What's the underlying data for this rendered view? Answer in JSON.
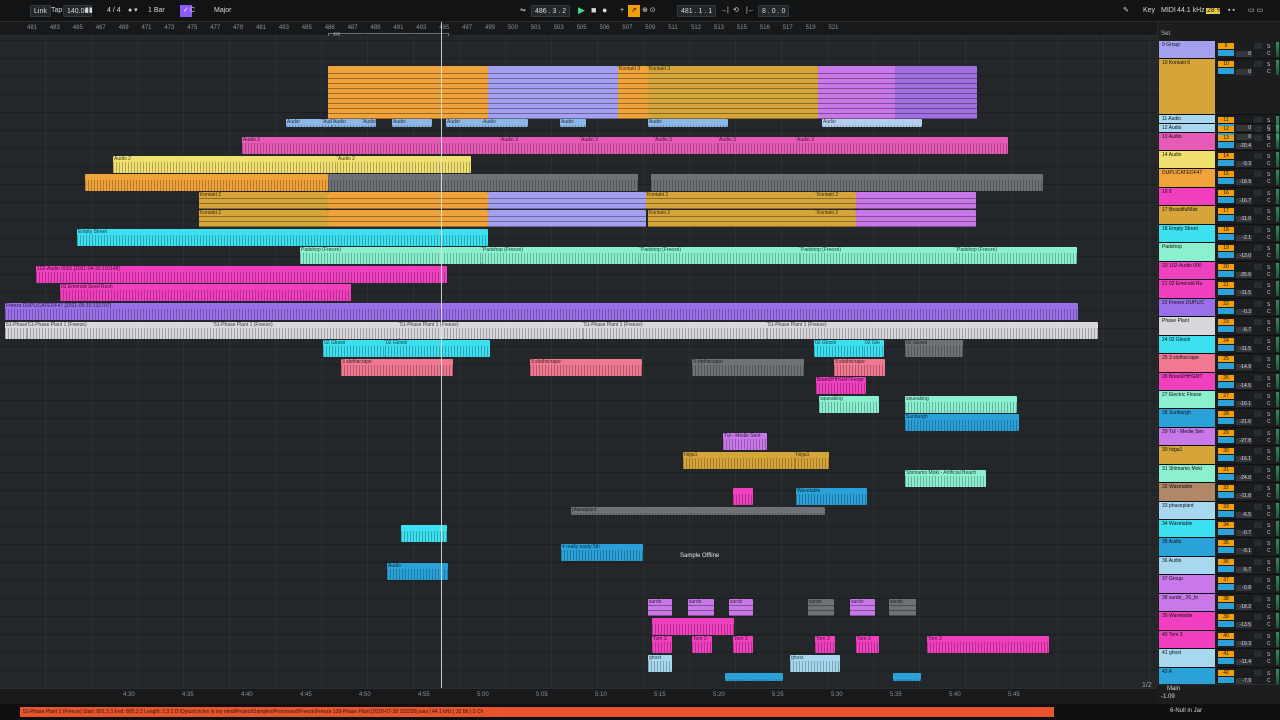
{
  "topbar": {
    "link": "Link",
    "tap": "Tap",
    "tempo": "140.00",
    "signature": "4 / 4",
    "quantize": "1 Bar",
    "key_root": "C",
    "scale": "Major",
    "position": "486 . 3 . 2",
    "loop_start": "481 . 1 . 1",
    "loop_length": "8 . 0 . 0",
    "key": "Key",
    "midi": "MIDI",
    "sample_rate": "44.1 kHz",
    "cpu": "28 %"
  },
  "ruler": {
    "bars": [
      "481",
      "483",
      "485",
      "467",
      "469",
      "471",
      "473",
      "475",
      "477",
      "479",
      "481",
      "483",
      "485",
      "486",
      "487",
      "489",
      "491",
      "493",
      "495",
      "497",
      "499",
      "500",
      "501",
      "503",
      "505",
      "506",
      "507",
      "509",
      "511",
      "512",
      "513",
      "515",
      "516",
      "517",
      "519",
      "521"
    ],
    "loop_label": "4/4"
  },
  "time_ruler": {
    "times": [
      "4:30",
      "4:35",
      "4:40",
      "4:45",
      "4:50",
      "4:55",
      "5:00",
      "5:05",
      "5:10",
      "5:15",
      "5:20",
      "5:25",
      "5:30",
      "5:35",
      "5:40",
      "5:45"
    ]
  },
  "arrangement": {
    "offline_text": "Sample Offline",
    "clips": [
      {
        "label": "",
        "color": "#f0a33a"
      },
      {
        "label": "",
        "color": "#a4a0f0"
      },
      {
        "label": "Kontakt 3",
        "color": "#f0a33a"
      },
      {
        "label": "Kontakt 3",
        "color": "#d6a53a"
      },
      {
        "label": "",
        "color": "#c878e8"
      },
      {
        "label": "",
        "color": "#a070e0"
      },
      {
        "label": "Audio",
        "color": "#8ab8e8"
      },
      {
        "label": "Audio",
        "color": "#8ab8e8"
      },
      {
        "label": "Audio",
        "color": "#8ab8e8"
      },
      {
        "label": "Audio",
        "color": "#8ab8e8"
      },
      {
        "label": "Audio",
        "color": "#8ab8e8"
      },
      {
        "label": "Audio",
        "color": "#8ab8e8"
      },
      {
        "label": "Audio",
        "color": "#8ab8e8"
      },
      {
        "label": "Audio",
        "color": "#8ab8e8"
      },
      {
        "label": "Audio",
        "color": "#8ab8e8"
      },
      {
        "label": "Audio",
        "color": "#b4d0f0"
      },
      {
        "label": "Audio 3",
        "color": "#e85ab8"
      },
      {
        "label": "Audio 3",
        "color": "#e85ab8"
      },
      {
        "label": "Audio 3",
        "color": "#e85ab8"
      },
      {
        "label": "Audio 3",
        "color": "#e85ab8"
      },
      {
        "label": "Audio 3",
        "color": "#e85ab8"
      },
      {
        "label": "Audio 3",
        "color": "#e85ab8"
      },
      {
        "label": "Audio 2",
        "color": "#f0e070"
      },
      {
        "label": "Audio 2",
        "color": "#f0e070"
      },
      {
        "label": "",
        "color": "#f0a33a"
      },
      {
        "label": "",
        "color": "#6e7276"
      },
      {
        "label": "",
        "color": "#6e7276"
      },
      {
        "label": "Kontakt 2",
        "color": "#d6a53a"
      },
      {
        "label": "",
        "color": "#f0a33a"
      },
      {
        "label": "",
        "color": "#a4a0f0"
      },
      {
        "label": "Kontakt 2",
        "color": "#d6a53a"
      },
      {
        "label": "Kontakt 2",
        "color": "#d6a53a"
      },
      {
        "label": "",
        "color": "#c878e8"
      },
      {
        "label": "Kontakt 2",
        "color": "#d6a53a"
      },
      {
        "label": "",
        "color": "#f0a33a"
      },
      {
        "label": "",
        "color": "#a4a0f0"
      },
      {
        "label": "Kontakt 2",
        "color": "#d6a53a"
      },
      {
        "label": "Kontakt 2",
        "color": "#d6a53a"
      },
      {
        "label": "",
        "color": "#c878e8"
      },
      {
        "label": "Empty Street",
        "color": "#3ce0f0"
      },
      {
        "label": "Padshop (Freeze)",
        "color": "#8af0d0"
      },
      {
        "label": "Padshop (Freeze)",
        "color": "#8af0d0"
      },
      {
        "label": "Padshop (Freeze)",
        "color": "#8af0d0"
      },
      {
        "label": "Padshop (Freeze)",
        "color": "#8af0d0"
      },
      {
        "label": "Padshop (Freeze)",
        "color": "#8af0d0"
      },
      {
        "label": "102-Audio 0001 [2021-04-30 110148]",
        "color": "#f040c0"
      },
      {
        "label": "02 Emerald Seed Rush",
        "color": "#f040c0"
      },
      {
        "label": "Freeze DUPLICATEOF47 [2021-05-10 131707]",
        "color": "#9a70e8"
      },
      {
        "label": "51-Phase Plant 1 (Freeze)",
        "color": "#d8d8dc"
      },
      {
        "label": "51-Phase Plant 1 (Freeze)",
        "color": "#d8d8dc"
      },
      {
        "label": "51-Phase Plant 1 (Freeze)",
        "color": "#d8d8dc"
      },
      {
        "label": "51-Phase Plant 1 (Freeze)",
        "color": "#d8d8dc"
      },
      {
        "label": "51-Phase Plant 1 (Freeze)",
        "color": "#d8d8dc"
      },
      {
        "label": "51-Phase Plant 1 (Freeze)",
        "color": "#d8d8dc"
      },
      {
        "label": "02 Glooiii",
        "color": "#3ce0f0"
      },
      {
        "label": "02 Glooiii",
        "color": "#3ce0f0"
      },
      {
        "label": "02 Glooiii",
        "color": "#3ce0f0"
      },
      {
        "label": "02 Glo",
        "color": "#3ce0f0"
      },
      {
        "label": "02 Glooiii",
        "color": "#6e7276"
      },
      {
        "label": "3 slothscrape",
        "color": "#f07890"
      },
      {
        "label": "3 slothscrape",
        "color": "#f07890"
      },
      {
        "label": "3 slothscrape",
        "color": "#6e7276"
      },
      {
        "label": "3 slothscrape",
        "color": "#f07890"
      },
      {
        "label": "BrianDHHGMTForge",
        "color": "#f040c0"
      },
      {
        "label": "squeaking",
        "color": "#8af0d0"
      },
      {
        "label": "squeaking",
        "color": "#8af0d0"
      },
      {
        "label": "Sunburgh",
        "color": "#2aa1d8"
      },
      {
        "label": "Tul - Medie Sent",
        "color": "#c878e8"
      },
      {
        "label": "hiiga1",
        "color": "#d6a53a"
      },
      {
        "label": "hiiga1",
        "color": "#d6a53a"
      },
      {
        "label": "Shimamo Moki - Artificial Beach",
        "color": "#8af0d0"
      },
      {
        "label": "",
        "color": "#f040c0"
      },
      {
        "label": "Wavetable",
        "color": "#2aa1d8"
      },
      {
        "label": "phaseplant",
        "color": "#6e7276"
      },
      {
        "label": "",
        "color": "#3ce0f0"
      },
      {
        "label": "4 really nasty 5th",
        "color": "#2aa1d8"
      },
      {
        "label": "Audio",
        "color": "#2aa1d8"
      },
      {
        "label": "surdo",
        "color": "#c878e8"
      },
      {
        "label": "surdo",
        "color": "#c878e8"
      },
      {
        "label": "surdo",
        "color": "#c878e8"
      },
      {
        "label": "surdo",
        "color": "#6e7276"
      },
      {
        "label": "surdo",
        "color": "#c878e8"
      },
      {
        "label": "surdo",
        "color": "#6e7276"
      },
      {
        "label": "",
        "color": "#f040c0"
      },
      {
        "label": "Tom 3",
        "color": "#f040c0"
      },
      {
        "label": "Tom 3",
        "color": "#f040c0"
      },
      {
        "label": "Tom 3",
        "color": "#f040c0"
      },
      {
        "label": "Tom 3",
        "color": "#f040c0"
      },
      {
        "label": "Tom 3",
        "color": "#f040c0"
      },
      {
        "label": "Tom 3",
        "color": "#f040c0"
      },
      {
        "label": "ghost",
        "color": "#a8d8f0"
      },
      {
        "label": "ghost",
        "color": "#a8d8f0"
      },
      {
        "label": "",
        "color": "#2aa1d8"
      },
      {
        "label": "",
        "color": "#2aa1d8"
      }
    ]
  },
  "mixer": {
    "set_label": "Set",
    "tracks": [
      {
        "name": "9 Group",
        "num": "9",
        "vol": "0",
        "pan": "C",
        "color": "#a4a0f0"
      },
      {
        "name": "10 Kontakt 6",
        "num": "10",
        "vol": "0",
        "pan": "C",
        "color": "#d6a53a"
      },
      {
        "name": "11 Audio",
        "num": "11",
        "vol": "0",
        "pan": "C",
        "color": "#a8d8f0"
      },
      {
        "name": "12 Audio",
        "num": "12",
        "vol": "0",
        "pan": "C",
        "color": "#a8d8f0"
      },
      {
        "name": "13 Audio",
        "num": "13",
        "vol": "-20.4",
        "pan": "C",
        "color": "#e85ab8"
      },
      {
        "name": "14 Audio",
        "num": "14",
        "vol": "-9.3",
        "pan": "C",
        "color": "#f0e070"
      },
      {
        "name": "DUPLICATEOF47",
        "num": "15",
        "vol": "-18.9",
        "pan": "C",
        "color": "#f0a33a"
      },
      {
        "name": "16 8",
        "num": "16",
        "vol": "-16.7",
        "pan": "C",
        "color": "#f040c0"
      },
      {
        "name": "17 BeautifulMist",
        "num": "17",
        "vol": "-11.0",
        "pan": "C",
        "color": "#d6a53a"
      },
      {
        "name": "18 Empty Street",
        "num": "18",
        "vol": "-2.1",
        "pan": "C",
        "color": "#3ce0f0"
      },
      {
        "name": "Padshop",
        "num": "19",
        "vol": "-13.0",
        "pan": "C",
        "color": "#8af0d0"
      },
      {
        "name": "20 102-Audio 000",
        "num": "20",
        "vol": "-25.6",
        "pan": "C",
        "color": "#f040c0"
      },
      {
        "name": "21 02 Emerald Ru",
        "num": "21",
        "vol": "-11.5",
        "pan": "C",
        "color": "#f040c0"
      },
      {
        "name": "22 Freeze DUPLIC",
        "num": "22",
        "vol": "-0.3",
        "pan": "C",
        "color": "#9a70e8"
      },
      {
        "name": "Phase Plant",
        "num": "23",
        "vol": "-6.7",
        "pan": "C",
        "color": "#d8d8dc"
      },
      {
        "name": "24 02 Glooiii",
        "num": "24",
        "vol": "-11.5",
        "pan": "C",
        "color": "#3ce0f0"
      },
      {
        "name": "25 3 slothscrape",
        "num": "25",
        "vol": "-14.9",
        "pan": "C",
        "color": "#f07890"
      },
      {
        "name": "26 BrianDHHGMT",
        "num": "26",
        "vol": "-14.5",
        "pan": "C",
        "color": "#f040c0"
      },
      {
        "name": "27 Electric Flosse",
        "num": "27",
        "vol": "-16.1",
        "pan": "C",
        "color": "#8af0d0"
      },
      {
        "name": "28 Sunburgh",
        "num": "28",
        "vol": "-21.6",
        "pan": "C",
        "color": "#2aa1d8"
      },
      {
        "name": "29 Tul - Medie Sen",
        "num": "29",
        "vol": "-27.8",
        "pan": "C",
        "color": "#c878e8"
      },
      {
        "name": "30 hiiga1",
        "num": "30",
        "vol": "-16.1",
        "pan": "C",
        "color": "#d6a53a"
      },
      {
        "name": "31 Shimamo Moki",
        "num": "31",
        "vol": "-24.0",
        "pan": "C",
        "color": "#8af0d0"
      },
      {
        "name": "32 Wavetable",
        "num": "32",
        "vol": "-11.8",
        "pan": "C",
        "color": "#b08868"
      },
      {
        "name": "33 phaseplant",
        "num": "33",
        "vol": "-6.5",
        "pan": "C",
        "color": "#a8d8f0"
      },
      {
        "name": "34 Wavetable",
        "num": "34",
        "vol": "-0.7",
        "pan": "C",
        "color": "#3ce0f0"
      },
      {
        "name": "35 Audio",
        "num": "35",
        "vol": "-9.1",
        "pan": "C",
        "color": "#2aa1d8"
      },
      {
        "name": "36 Audio",
        "num": "36",
        "vol": "-5.7",
        "pan": "C",
        "color": "#a8d8f0"
      },
      {
        "name": "37 Group",
        "num": "37",
        "vol": "-0.8",
        "pan": "C",
        "color": "#c878e8"
      },
      {
        "name": "38 surdo_ 26_fo",
        "num": "38",
        "vol": "-18.2",
        "pan": "C",
        "color": "#c878e8"
      },
      {
        "name": "39 Wavetable",
        "num": "39",
        "vol": "-13.5",
        "pan": "C",
        "color": "#f040c0"
      },
      {
        "name": "40 Tom 3",
        "num": "40",
        "vol": "-19.3",
        "pan": "C",
        "color": "#f040c0"
      },
      {
        "name": "41 ghost",
        "num": "41",
        "vol": "-11.4",
        "pan": "C",
        "color": "#a8d8f0"
      },
      {
        "name": "42 A",
        "num": "42",
        "vol": "-7.9",
        "pan": "C",
        "color": "#2aa1d8"
      }
    ],
    "main_label": "Main",
    "main_vol": "-1.09",
    "page_indicator": "1/2"
  },
  "statusbar": {
    "text": "51-Phase Plant 1 (Freeze)  Start: 801.3.3  End: 805.3.3  Length: 2.3.2  D:\\Dylus\\circles in my mind\\Project\\Samples\\Processed\\Freeze\\Freeze 138-Phase Plant [2020-07-30 152250].wav | 44.1 kHz | 32 Bit | 2 Ch",
    "midi_route": "6-Null in Jar"
  }
}
